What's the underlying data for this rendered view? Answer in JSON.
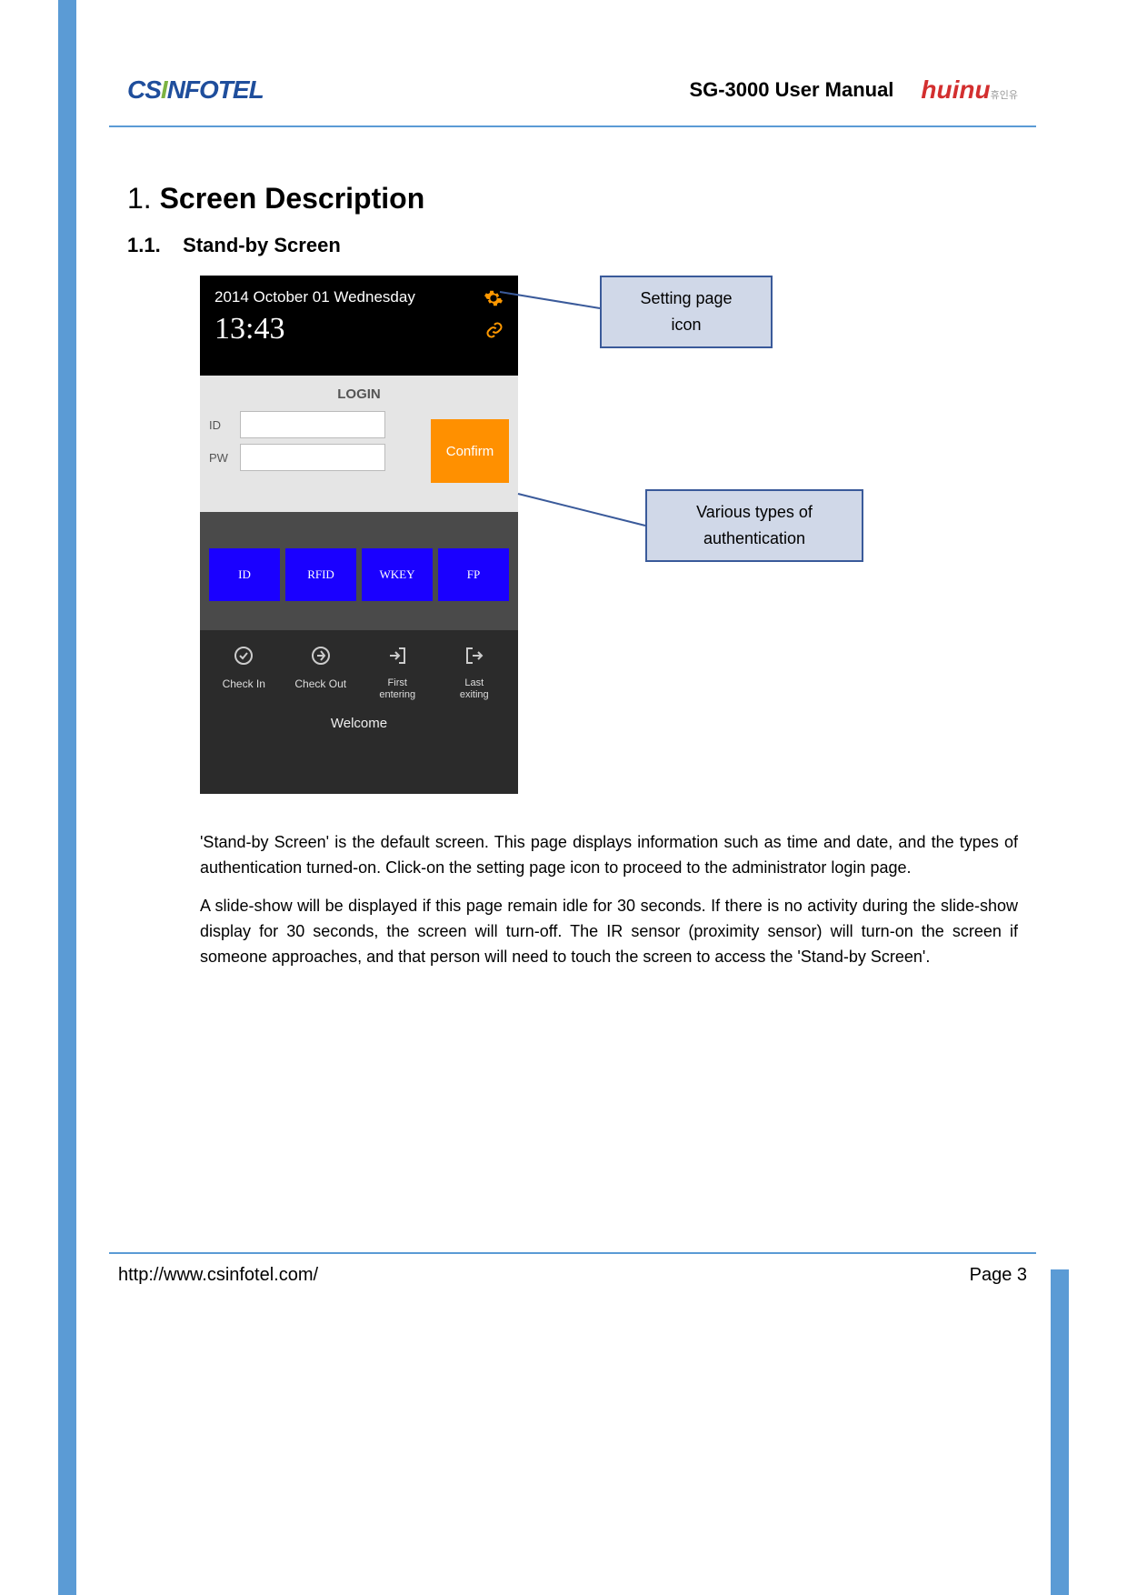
{
  "header": {
    "logo_left_1": "CS",
    "logo_left_2": "I",
    "logo_left_3": "NFOTEL",
    "title": "SG-3000 User Manual",
    "logo_right": "huinu",
    "logo_right_sub": "휴인유"
  },
  "section": {
    "number": "1.",
    "title": "Screen Description",
    "sub_number": "1.1.",
    "sub_title": "Stand-by Screen"
  },
  "device": {
    "date": "2014 October 01 Wednesday",
    "time": "13:43",
    "login_title": "LOGIN",
    "id_label": "ID",
    "pw_label": "PW",
    "confirm": "Confirm",
    "auth": [
      "ID",
      "RFID",
      "WKEY",
      "FP"
    ],
    "bottom": [
      {
        "label": "Check In"
      },
      {
        "label": "Check Out"
      },
      {
        "label1": "First",
        "label2": "entering"
      },
      {
        "label1": "Last",
        "label2": "exiting"
      }
    ],
    "welcome": "Welcome"
  },
  "callouts": {
    "c1_l1": "Setting page",
    "c1_l2": "icon",
    "c2_l1": "Various types of",
    "c2_l2": "authentication"
  },
  "body": {
    "p1": "'Stand-by Screen' is the default screen. This page displays information such as time and date, and the types of authentication turned-on. Click-on the setting page icon to proceed to the administrator login page.",
    "p2": "A slide-show will be displayed if this page remain idle for 30 seconds. If there is no activity during the slide-show display for 30 seconds, the screen will turn-off. The IR sensor (proximity sensor) will turn-on the screen if someone approaches, and that person will need to touch the screen to access the 'Stand-by Screen'."
  },
  "footer": {
    "url": "http://www.csinfotel.com/",
    "page_label": "Page ",
    "page_num": "3"
  }
}
